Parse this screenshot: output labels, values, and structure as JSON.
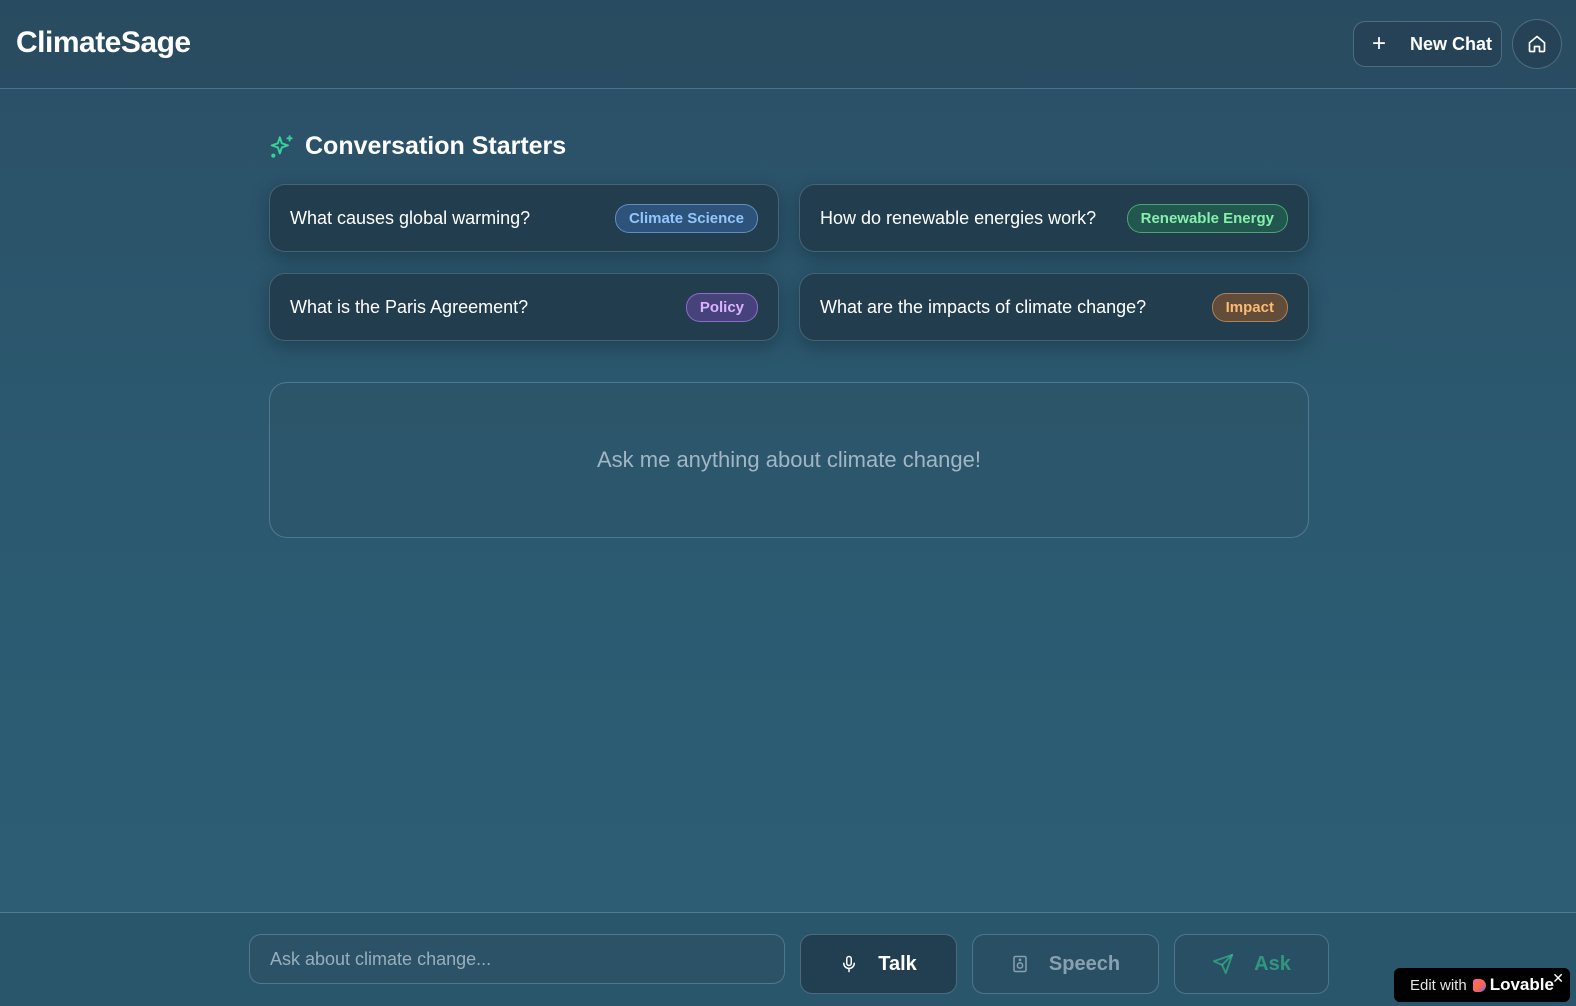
{
  "header": {
    "brand": "ClimateSage",
    "new_chat_label": "New Chat",
    "new_chat_icon": "plus-icon",
    "home_icon": "home-icon"
  },
  "starters": {
    "title": "Conversation Starters",
    "icon": "sparkles-icon",
    "items": [
      {
        "question": "What causes global warming?",
        "tag": "Climate Science",
        "tag_color": "#93c5fd"
      },
      {
        "question": "How do renewable energies work?",
        "tag": "Renewable Energy",
        "tag_color": "#86efac"
      },
      {
        "question": "What is the Paris Agreement?",
        "tag": "Policy",
        "tag_color": "#d8b4fe"
      },
      {
        "question": "What are the impacts of climate change?",
        "tag": "Impact",
        "tag_color": "#fdba74"
      }
    ]
  },
  "chat": {
    "empty_message": "Ask me anything about climate change!"
  },
  "footer": {
    "input_placeholder": "Ask about climate change...",
    "input_value": "",
    "talk_label": "Talk",
    "talk_icon": "microphone-icon",
    "speech_label": "Speech",
    "speech_icon": "speaker-icon",
    "ask_label": "Ask",
    "ask_icon": "send-icon"
  },
  "badge": {
    "prefix": "Edit with",
    "brand": "Lovable",
    "close": "✕"
  },
  "colors": {
    "accent": "#34d399",
    "background": "#2b5a70"
  }
}
